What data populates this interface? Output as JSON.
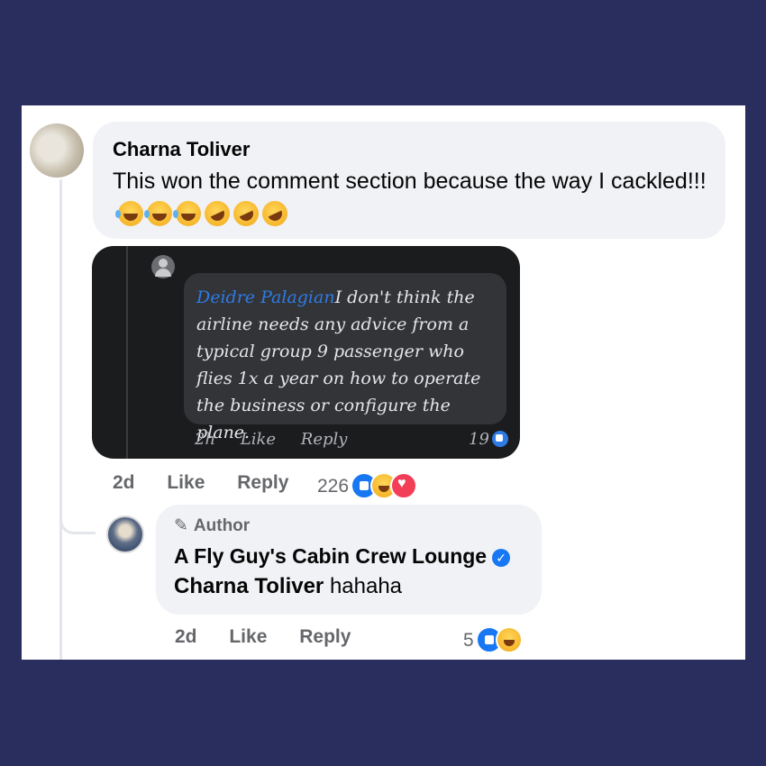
{
  "comment": {
    "author": "Charna Toliver",
    "text": "This won the comment section because the way I cackled!!!",
    "emojis": [
      "joy-emoji",
      "joy-emoji",
      "joy-emoji",
      "rofl-emoji",
      "rofl-emoji",
      "rofl-emoji"
    ],
    "time": "2d",
    "like_label": "Like",
    "reply_label": "Reply",
    "reaction_count": "226",
    "reactions": [
      "like",
      "haha",
      "love"
    ]
  },
  "embedded_screenshot": {
    "name": "Deidre Palagian",
    "text": "I don't think the airline needs any advice from a typical group 9 passenger who flies 1x a year on how to operate the business or configure the plane.",
    "time": "2h",
    "like_label": "Like",
    "reply_label": "Reply",
    "reaction_count": "19"
  },
  "reply": {
    "badge": "Author",
    "page_name": "A Fly Guy's Cabin Crew Lounge",
    "mention": "Charna Toliver",
    "text": "hahaha",
    "time": "2d",
    "like_label": "Like",
    "reply_label": "Reply",
    "reaction_count": "5",
    "reactions": [
      "like",
      "haha"
    ]
  },
  "colors": {
    "background": "#2a2e5e",
    "bubble": "#f0f2f5",
    "link_blue": "#1877f2",
    "muted_text": "#65676b"
  }
}
